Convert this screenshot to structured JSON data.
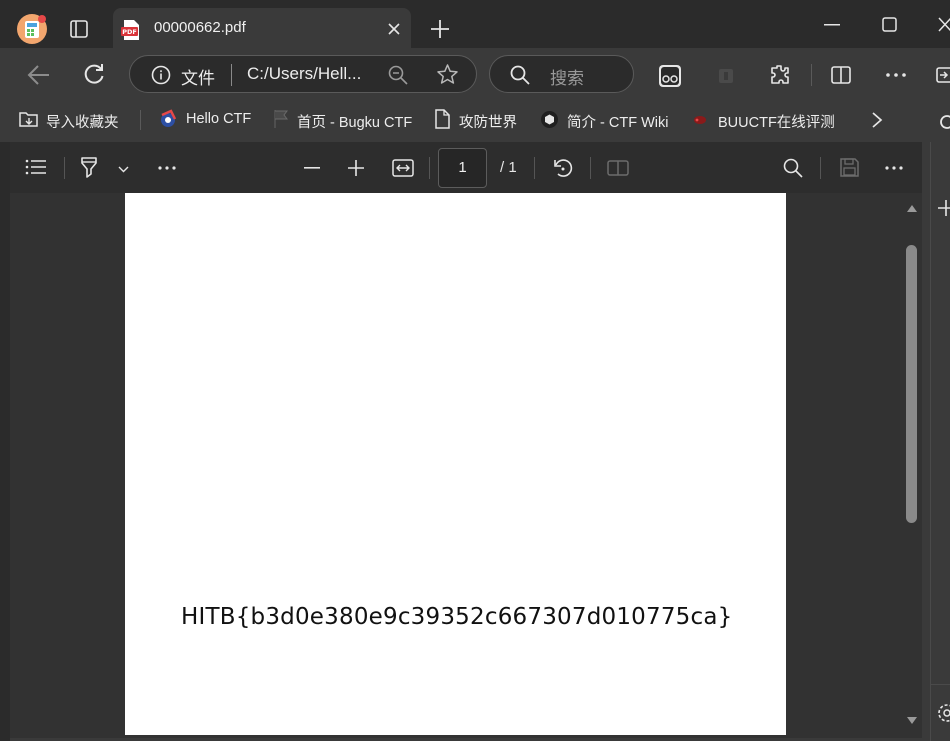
{
  "tabs": {
    "active_title": "00000662.pdf",
    "new_tab_symbol": "+"
  },
  "address_bar": {
    "label": "文件",
    "url": "C:/Users/Hell..."
  },
  "search": {
    "placeholder": "搜索"
  },
  "bookmarks": {
    "import_label": "导入收藏夹",
    "items": [
      {
        "label": "Hello CTF"
      },
      {
        "label": "首页 - Bugku CTF"
      },
      {
        "label": "攻防世界"
      },
      {
        "label": "简介 - CTF Wiki"
      },
      {
        "label": "BUUCTF在线评测"
      }
    ]
  },
  "pdf_toolbar": {
    "current_page": "1",
    "total_pages": "/ 1"
  },
  "document": {
    "flag_text": "HITB{b3d0e380e9c39352c667307d010775ca}"
  },
  "colors": {
    "titlebar": "#2b2b2b",
    "toolbar": "#3a3a3a",
    "pdf_toolbar": "#2d2d2d",
    "page": "#ffffff"
  }
}
